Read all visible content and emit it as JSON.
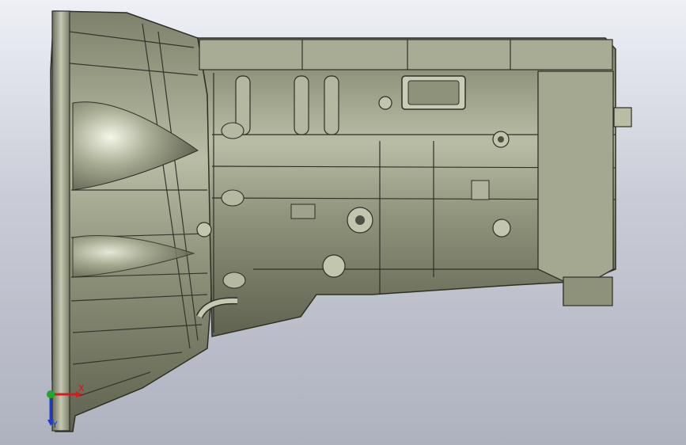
{
  "viewport": {
    "background_top": "#eef0f6",
    "background_bottom": "#aeb2bf",
    "model_color": "#9a9f85"
  },
  "triad": {
    "x_label": "X",
    "y_label": "Y",
    "x_color": "#d21e1e",
    "y_color": "#1ea82a",
    "z_color": "#1e3cd2"
  }
}
